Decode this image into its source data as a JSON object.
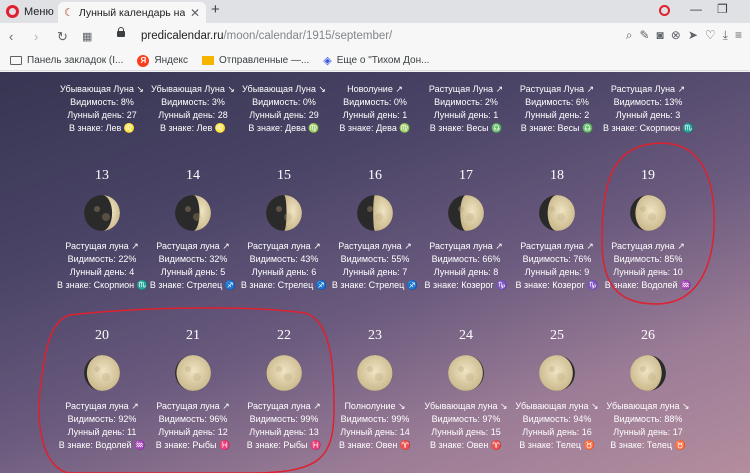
{
  "browser": {
    "menu_label": "Меню",
    "tab_title": "Лунный календарь на Се",
    "url_host": "predicalendar.ru",
    "url_path": "/moon/calendar/1915/september/",
    "bookmarks": [
      {
        "label": "Панель закладок (I...",
        "icon": "folder-icon"
      },
      {
        "label": "Яндекс",
        "icon": "yandex-icon"
      },
      {
        "label": "Отправленные —...",
        "icon": "mail-icon"
      },
      {
        "label": "Еще о \"Тихом Дон...",
        "icon": "shield-icon"
      }
    ]
  },
  "labels": {
    "visibility": "Видимость:",
    "lunar_day": "Лунный день:",
    "in_sign": "В знаке:"
  },
  "days_top_row": [
    {
      "phase": "Убывающая Луна",
      "arrow": "↘",
      "visibility": "8%",
      "lunar_day": "27",
      "sign": "Лев",
      "sign_glyph": "♌"
    },
    {
      "phase": "Убывающая Луна",
      "arrow": "↘",
      "visibility": "3%",
      "lunar_day": "28",
      "sign": "Лев",
      "sign_glyph": "♌"
    },
    {
      "phase": "Убывающая Луна",
      "arrow": "↘",
      "visibility": "0%",
      "lunar_day": "29",
      "sign": "Дева",
      "sign_glyph": "♍"
    },
    {
      "phase": "Новолуние",
      "arrow": "↗",
      "visibility": "0%",
      "lunar_day": "1",
      "sign": "Дева",
      "sign_glyph": "♍"
    },
    {
      "phase": "Растущая Луна",
      "arrow": "↗",
      "visibility": "2%",
      "lunar_day": "1",
      "sign": "Весы",
      "sign_glyph": "♎"
    },
    {
      "phase": "Растущая Луна",
      "arrow": "↗",
      "visibility": "6%",
      "lunar_day": "2",
      "sign": "Весы",
      "sign_glyph": "♎"
    },
    {
      "phase": "Растущая Луна",
      "arrow": "↗",
      "visibility": "13%",
      "lunar_day": "3",
      "sign": "Скорпион",
      "sign_glyph": "♏"
    }
  ],
  "days_row2": [
    {
      "num": "13",
      "phase": "Растущая луна",
      "arrow": "↗",
      "visibility": "22%",
      "lunar_day": "4",
      "sign": "Скорпион",
      "sign_glyph": "♏",
      "illum": 0.22
    },
    {
      "num": "14",
      "phase": "Растущая луна",
      "arrow": "↗",
      "visibility": "32%",
      "lunar_day": "5",
      "sign": "Стрелец",
      "sign_glyph": "♐",
      "illum": 0.32
    },
    {
      "num": "15",
      "phase": "Растущая луна",
      "arrow": "↗",
      "visibility": "43%",
      "lunar_day": "6",
      "sign": "Стрелец",
      "sign_glyph": "♐",
      "illum": 0.43
    },
    {
      "num": "16",
      "phase": "Растущая луна",
      "arrow": "↗",
      "visibility": "55%",
      "lunar_day": "7",
      "sign": "Стрелец",
      "sign_glyph": "♐",
      "illum": 0.55
    },
    {
      "num": "17",
      "phase": "Растущая луна",
      "arrow": "↗",
      "visibility": "66%",
      "lunar_day": "8",
      "sign": "Козерог",
      "sign_glyph": "♑",
      "illum": 0.66
    },
    {
      "num": "18",
      "phase": "Растущая луна",
      "arrow": "↗",
      "visibility": "76%",
      "lunar_day": "9",
      "sign": "Козерог",
      "sign_glyph": "♑",
      "illum": 0.76
    },
    {
      "num": "19",
      "phase": "Растущая луна",
      "arrow": "↗",
      "visibility": "85%",
      "lunar_day": "10",
      "sign": "Водолей",
      "sign_glyph": "♒",
      "illum": 0.85
    }
  ],
  "days_row3": [
    {
      "num": "20",
      "phase": "Растущая луна",
      "arrow": "↗",
      "visibility": "92%",
      "lunar_day": "11",
      "sign": "Водолей",
      "sign_glyph": "♒",
      "illum": 0.92
    },
    {
      "num": "21",
      "phase": "Растущая луна",
      "arrow": "↗",
      "visibility": "96%",
      "lunar_day": "12",
      "sign": "Рыбы",
      "sign_glyph": "♓",
      "illum": 0.96
    },
    {
      "num": "22",
      "phase": "Растущая луна",
      "arrow": "↗",
      "visibility": "99%",
      "lunar_day": "13",
      "sign": "Рыбы",
      "sign_glyph": "♓",
      "illum": 0.99
    },
    {
      "num": "23",
      "phase": "Полнолуние",
      "arrow": "↘",
      "visibility": "99%",
      "lunar_day": "14",
      "sign": "Овен",
      "sign_glyph": "♈",
      "illum": 0.99
    },
    {
      "num": "24",
      "phase": "Убывающая луна",
      "arrow": "↘",
      "visibility": "97%",
      "lunar_day": "15",
      "sign": "Овен",
      "sign_glyph": "♈",
      "illum": 0.97
    },
    {
      "num": "25",
      "phase": "Убывающая луна",
      "arrow": "↘",
      "visibility": "94%",
      "lunar_day": "16",
      "sign": "Телец",
      "sign_glyph": "♉",
      "illum": 0.94
    },
    {
      "num": "26",
      "phase": "Убывающая луна",
      "arrow": "↘",
      "visibility": "88%",
      "lunar_day": "17",
      "sign": "Телец",
      "sign_glyph": "♉",
      "illum": 0.88
    }
  ],
  "colors": {
    "annotation": "#e0202e",
    "moon_lit": "#e2d3ad",
    "moon_dark": "#2b2a2a"
  }
}
